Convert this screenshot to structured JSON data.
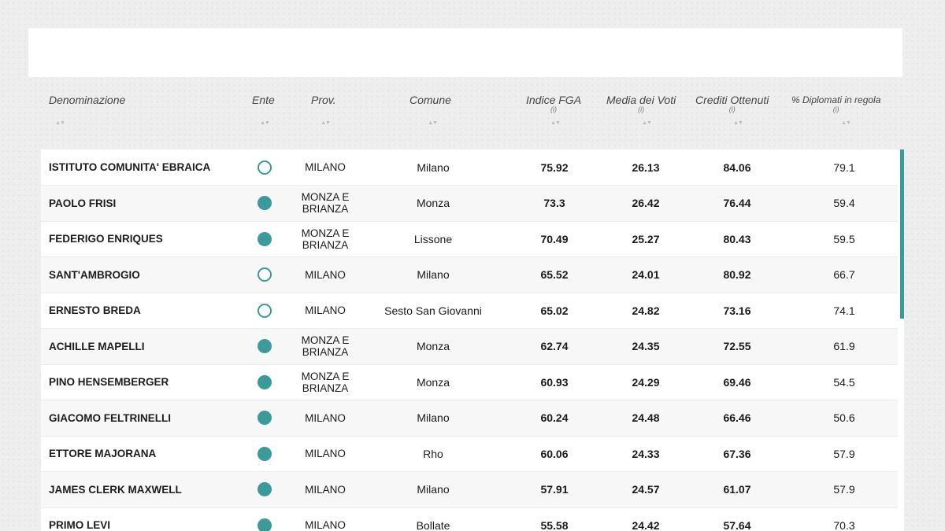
{
  "columns": {
    "denominazione": "Denominazione",
    "ente": "Ente",
    "prov": "Prov.",
    "comune": "Comune",
    "indice_fga": "Indice FGA",
    "media_voti": "Media dei Voti",
    "crediti": "Crediti Ottenuti",
    "diplomati": "% Diplomati in regola",
    "info_marker": "(i)",
    "sort_glyph": "▲▼"
  },
  "ente_legend": {
    "filled": "filled-circle-icon",
    "hollow": "hollow-circle-icon"
  },
  "accent_color": "#3d9a9b",
  "rows": [
    {
      "name": "ISTITUTO COMUNITA' EBRAICA",
      "ente": "hollow",
      "prov": "MILANO",
      "comune": "Milano",
      "fga": "75.92",
      "media": "26.13",
      "crediti": "84.06",
      "dipl": "79.1"
    },
    {
      "name": "PAOLO FRISI",
      "ente": "filled",
      "prov": "MONZA E BRIANZA",
      "comune": "Monza",
      "fga": "73.3",
      "media": "26.42",
      "crediti": "76.44",
      "dipl": "59.4"
    },
    {
      "name": "FEDERIGO ENRIQUES",
      "ente": "filled",
      "prov": "MONZA E BRIANZA",
      "comune": "Lissone",
      "fga": "70.49",
      "media": "25.27",
      "crediti": "80.43",
      "dipl": "59.5"
    },
    {
      "name": "SANT'AMBROGIO",
      "ente": "hollow",
      "prov": "MILANO",
      "comune": "Milano",
      "fga": "65.52",
      "media": "24.01",
      "crediti": "80.92",
      "dipl": "66.7"
    },
    {
      "name": "ERNESTO BREDA",
      "ente": "hollow",
      "prov": "MILANO",
      "comune": "Sesto San Giovanni",
      "fga": "65.02",
      "media": "24.82",
      "crediti": "73.16",
      "dipl": "74.1"
    },
    {
      "name": "ACHILLE MAPELLI",
      "ente": "filled",
      "prov": "MONZA E BRIANZA",
      "comune": "Monza",
      "fga": "62.74",
      "media": "24.35",
      "crediti": "72.55",
      "dipl": "61.9"
    },
    {
      "name": "PINO HENSEMBERGER",
      "ente": "filled",
      "prov": "MONZA E BRIANZA",
      "comune": "Monza",
      "fga": "60.93",
      "media": "24.29",
      "crediti": "69.46",
      "dipl": "54.5"
    },
    {
      "name": "GIACOMO FELTRINELLI",
      "ente": "filled",
      "prov": "MILANO",
      "comune": "Milano",
      "fga": "60.24",
      "media": "24.48",
      "crediti": "66.46",
      "dipl": "50.6"
    },
    {
      "name": "ETTORE MAJORANA",
      "ente": "filled",
      "prov": "MILANO",
      "comune": "Rho",
      "fga": "60.06",
      "media": "24.33",
      "crediti": "67.36",
      "dipl": "57.9"
    },
    {
      "name": "JAMES CLERK MAXWELL",
      "ente": "filled",
      "prov": "MILANO",
      "comune": "Milano",
      "fga": "57.91",
      "media": "24.57",
      "crediti": "61.07",
      "dipl": "57.9"
    },
    {
      "name": "PRIMO LEVI",
      "ente": "filled",
      "prov": "MILANO",
      "comune": "Bollate",
      "fga": "55.58",
      "media": "24.42",
      "crediti": "57.64",
      "dipl": "70.3"
    }
  ]
}
